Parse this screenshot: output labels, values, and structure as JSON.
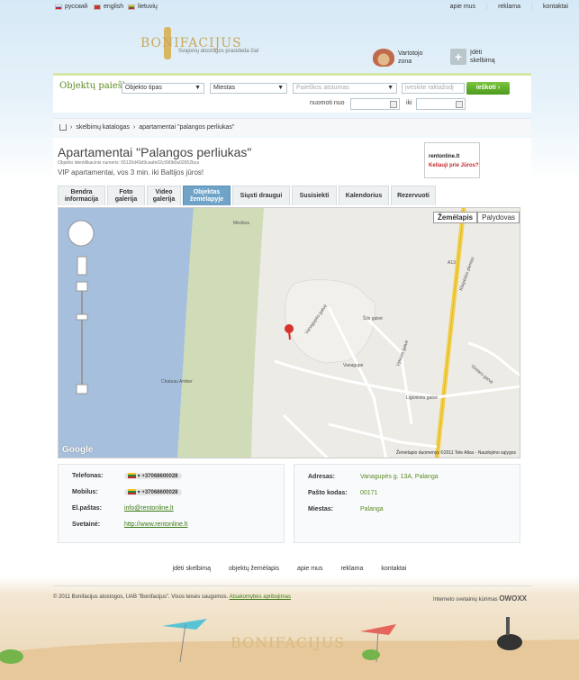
{
  "languages": [
    {
      "label": "русский",
      "flag_color": "#d22"
    },
    {
      "label": "english",
      "flag_color": "#c33"
    },
    {
      "label": "lietuvių",
      "flag_color": "#1f8a3d"
    }
  ],
  "top_links": [
    "apie mus",
    "reklama",
    "kontaktai"
  ],
  "logo": {
    "tagline": "Svajonių atostogos prasideda čia!",
    "word": "BONIFACIJUS"
  },
  "user_zone": {
    "line1": "Vartotojo",
    "line2": "zona"
  },
  "add_ad": {
    "line1": "Įdėti",
    "line2": "skelbimą"
  },
  "search": {
    "title": "Objektų paieška",
    "type_placeholder": "Objekto tipas",
    "city_placeholder": "Miestas",
    "distance_placeholder": "Paieškos atstumas",
    "keyword_placeholder": "įveskite raktažodį",
    "button": "ieškoti",
    "date_from_label": "nuomoti nuo",
    "date_to_label": "iki"
  },
  "breadcrumb": [
    "skelbimų katalogas",
    "apartamentai \"palangos perliukas\""
  ],
  "listing": {
    "title": "Apartamentai \"Palangos perliukas\"",
    "object_id": "Objekto identifikacinis numeris: 65126d43d9caafe02c990b0a02652bca",
    "subtitle": "VIP apartamentai, vos 3 min. iki Baltijos jūros!",
    "banner_logo": "rentonline.lt",
    "banner_text": "Keliauji prie Jūros?"
  },
  "tabs": [
    {
      "line1": "Bendra",
      "line2": "informacija"
    },
    {
      "line1": "Foto",
      "line2": "galerija"
    },
    {
      "line1": "Video",
      "line2": "galerija"
    },
    {
      "line1": "Objektas",
      "line2": "žemėlapyje"
    },
    {
      "line1": "Siųsti draugui",
      "line2": ""
    },
    {
      "line1": "Susisiekti",
      "line2": ""
    },
    {
      "line1": "Kalendorius",
      "line2": ""
    },
    {
      "line1": "Rezervuoti",
      "line2": ""
    }
  ],
  "map": {
    "types": [
      "Žemėlapis",
      "Palydovas"
    ],
    "labels": [
      "Medūza",
      "Chateau Amber",
      "Šilo gatvė",
      "Vanagupės gatvė",
      "Vytauto gatvė",
      "Ligoninės gatvė",
      "Klaipėdos plentas",
      "Vanagupė",
      "Gintaro gatvė",
      "A13"
    ],
    "copyright": "Žemėlapio duomenys ©2011 Tele Atlas - Naudojimo sąlygos",
    "provider": "Google"
  },
  "contacts": {
    "phone_label": "Telefonas:",
    "phone": "+37068600028",
    "mobile_label": "Mobilus:",
    "mobile": "+37068600028",
    "email_label": "El.paštas:",
    "email": "info@rentonline.lt",
    "website_label": "Svetainė:",
    "website": "http://www.rentonline.lt"
  },
  "address": {
    "address_label": "Adresas:",
    "address": "Vanagupės g. 13A, Palanga",
    "postcode_label": "Pašto kodas:",
    "postcode": "00171",
    "city_label": "Miestas:",
    "city": "Palanga"
  },
  "footer": {
    "links": [
      "įdėti skelbimą",
      "objektų žemėlapis",
      "apie mus",
      "reklama",
      "kontaktai"
    ],
    "copyright": "© 2011 Bonifacijus atostogos, UAB \"Bonifacijus\". Visos teisės saugomos.",
    "policy": "Atsakomybės apribojimas",
    "developer_prefix": "Interneto svetainių kūrimas",
    "developer": "OWOXX",
    "beach_logo": "BONIFACIJUS"
  },
  "colors": {
    "accent": "#5c8a22",
    "tab_active": "#6fa3c8",
    "search_button": "#5aa826"
  }
}
